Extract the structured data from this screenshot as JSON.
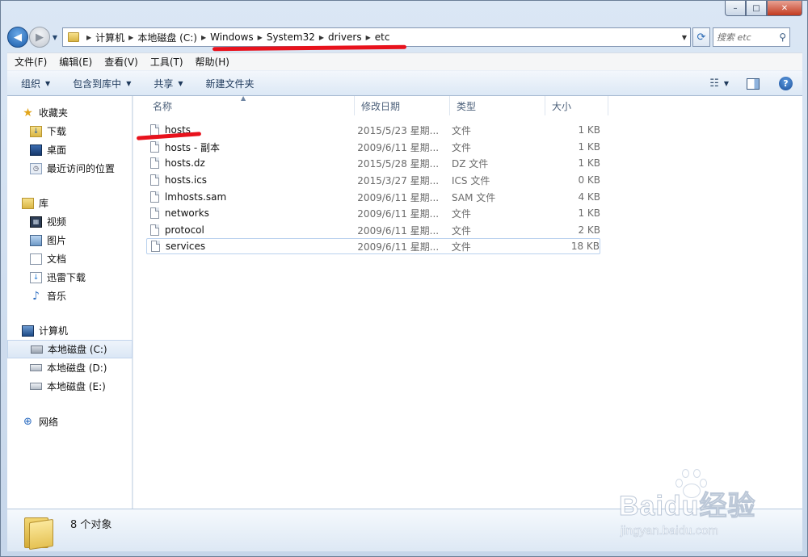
{
  "window": {
    "minimize": "–",
    "maximize": "□",
    "close": "✕"
  },
  "address": {
    "crumbs": [
      "计算机",
      "本地磁盘 (C:)",
      "Windows",
      "System32",
      "drivers",
      "etc"
    ],
    "search_placeholder": "搜索 etc"
  },
  "menubar": [
    "文件(F)",
    "编辑(E)",
    "查看(V)",
    "工具(T)",
    "帮助(H)"
  ],
  "toolbar": {
    "organize": "组织",
    "include_in_library": "包含到库中",
    "share": "共享",
    "new_folder": "新建文件夹"
  },
  "nav": {
    "favorites_head": "收藏夹",
    "favorites": [
      "下载",
      "桌面",
      "最近访问的位置"
    ],
    "libraries_head": "库",
    "libraries": [
      "视频",
      "图片",
      "文档",
      "迅雷下载",
      "音乐"
    ],
    "computer_head": "计算机",
    "drives": [
      "本地磁盘 (C:)",
      "本地磁盘 (D:)",
      "本地磁盘 (E:)"
    ],
    "network_head": "网络"
  },
  "columns": {
    "name": "名称",
    "date": "修改日期",
    "type": "类型",
    "size": "大小"
  },
  "files": [
    {
      "name": "hosts",
      "date": "2015/5/23 星期...",
      "type": "文件",
      "size": "1 KB"
    },
    {
      "name": "hosts - 副本",
      "date": "2009/6/11 星期...",
      "type": "文件",
      "size": "1 KB"
    },
    {
      "name": "hosts.dz",
      "date": "2015/5/28 星期...",
      "type": "DZ 文件",
      "size": "1 KB"
    },
    {
      "name": "hosts.ics",
      "date": "2015/3/27 星期...",
      "type": "ICS 文件",
      "size": "0 KB"
    },
    {
      "name": "lmhosts.sam",
      "date": "2009/6/11 星期...",
      "type": "SAM 文件",
      "size": "4 KB"
    },
    {
      "name": "networks",
      "date": "2009/6/11 星期...",
      "type": "文件",
      "size": "1 KB"
    },
    {
      "name": "protocol",
      "date": "2009/6/11 星期...",
      "type": "文件",
      "size": "2 KB"
    },
    {
      "name": "services",
      "date": "2009/6/11 星期...",
      "type": "文件",
      "size": "18 KB"
    }
  ],
  "status": {
    "count": "8 个对象"
  },
  "watermark": {
    "brand": "Baidu经验",
    "url": "jingyan.baidu.com"
  },
  "colors": {
    "annotation_red": "#e8121c",
    "selection_border": "#b9d1ee"
  }
}
